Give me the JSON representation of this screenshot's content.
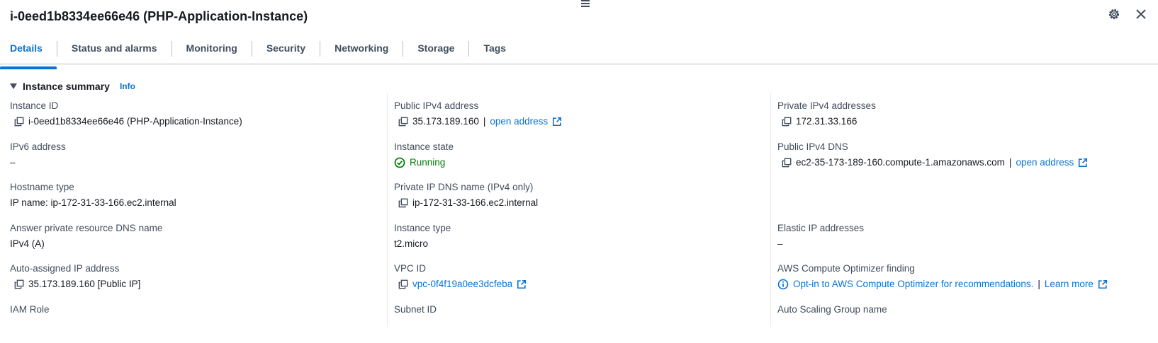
{
  "header": {
    "title": "i-0eed1b8334ee66e46 (PHP-Application-Instance)",
    "settings_icon": "gear-icon",
    "close_icon": "close-icon"
  },
  "tabs": [
    {
      "label": "Details",
      "active": true
    },
    {
      "label": "Status and alarms",
      "active": false
    },
    {
      "label": "Monitoring",
      "active": false
    },
    {
      "label": "Security",
      "active": false
    },
    {
      "label": "Networking",
      "active": false
    },
    {
      "label": "Storage",
      "active": false
    },
    {
      "label": "Tags",
      "active": false
    }
  ],
  "summary": {
    "title": "Instance summary",
    "info": "Info",
    "col1": {
      "instance_id_label": "Instance ID",
      "instance_id_value": "i-0eed1b8334ee66e46 (PHP-Application-Instance)",
      "ipv6_label": "IPv6 address",
      "ipv6_value": "–",
      "hostname_type_label": "Hostname type",
      "hostname_type_value": "IP name: ip-172-31-33-166.ec2.internal",
      "answer_dns_label": "Answer private resource DNS name",
      "answer_dns_value": "IPv4 (A)",
      "auto_ip_label": "Auto-assigned IP address",
      "auto_ip_value": "35.173.189.160 [Public IP]",
      "iam_role_label": "IAM Role"
    },
    "col2": {
      "public_ipv4_label": "Public IPv4 address",
      "public_ipv4_value": "35.173.189.160",
      "separator": "|",
      "open_address": "open address",
      "state_label": "Instance state",
      "state_value": "Running",
      "private_dns_label": "Private IP DNS name (IPv4 only)",
      "private_dns_value": "ip-172-31-33-166.ec2.internal",
      "type_label": "Instance type",
      "type_value": "t2.micro",
      "vpc_label": "VPC ID",
      "vpc_value": "vpc-0f4f19a0ee3dcfeba",
      "subnet_label": "Subnet ID"
    },
    "col3": {
      "private_ipv4_label": "Private IPv4 addresses",
      "private_ipv4_value": "172.31.33.166",
      "public_dns_label": "Public IPv4 DNS",
      "public_dns_value": "ec2-35-173-189-160.compute-1.amazonaws.com",
      "separator": "|",
      "open_address": "open address",
      "elastic_ip_label": "Elastic IP addresses",
      "elastic_ip_value": "–",
      "optimizer_label": "AWS Compute Optimizer finding",
      "optimizer_link": "Opt-in to AWS Compute Optimizer for recommendations.",
      "learn_more": "Learn more",
      "asg_label": "Auto Scaling Group name"
    }
  },
  "colors": {
    "link": "#0972d3",
    "running": "#037f0c",
    "label": "#414d5c",
    "text": "#16191f"
  }
}
